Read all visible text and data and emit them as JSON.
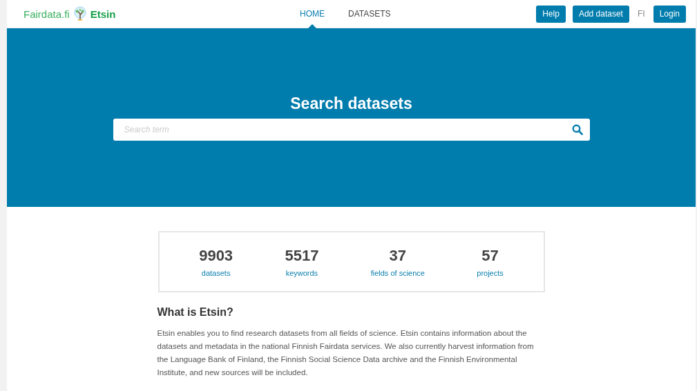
{
  "header": {
    "brand": "Fairdata.fi",
    "product": "Etsin",
    "nav": [
      {
        "label": "HOME",
        "selected": true
      },
      {
        "label": "DATASETS",
        "selected": false
      }
    ],
    "buttons": [
      "Help",
      "Add dataset"
    ],
    "language": "FI",
    "login": "Login"
  },
  "hero": {
    "title": "Search datasets",
    "search": {
      "placeholder": "Search term"
    }
  },
  "stats": [
    {
      "value": "9903",
      "label": "datasets"
    },
    {
      "value": "5517",
      "label": "keywords"
    },
    {
      "value": "37",
      "label": "fields of science"
    },
    {
      "value": "57",
      "label": "projects"
    }
  ],
  "about": {
    "title": "What is Etsin?",
    "text": "Etsin enables you to find research datasets from all fields of science. Etsin contains information about the datasets and metadata in the national Finnish Fairdata services. We also currently harvest information from the Language Bank of Finland, the Finnish Social Science Data archive and the Finnish Environmental Institute, and new sources will be included."
  }
}
